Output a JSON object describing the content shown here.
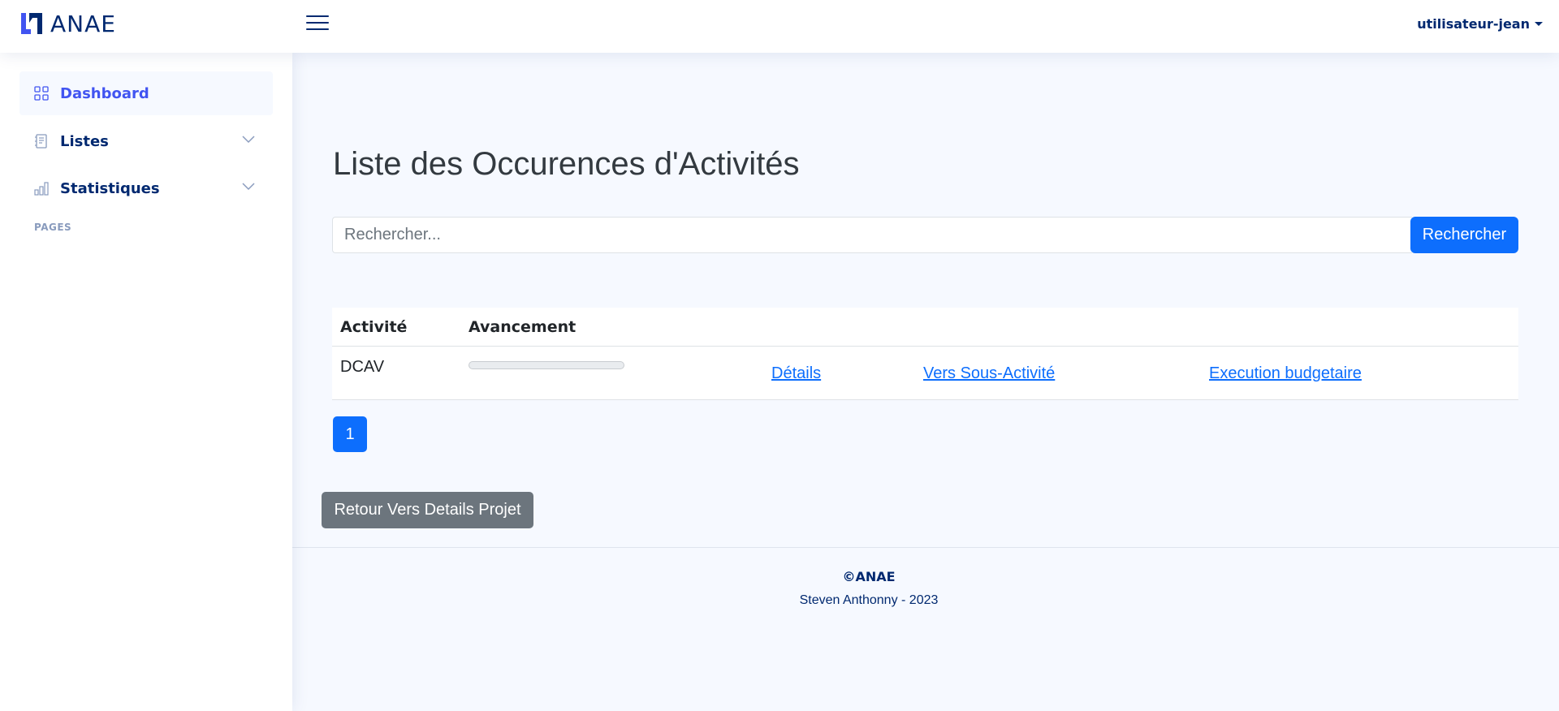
{
  "header": {
    "brand": "ANAE",
    "user": "utilisateur-jean"
  },
  "sidebar": {
    "items": [
      {
        "label": "Dashboard",
        "icon": "grid-icon",
        "active": true
      },
      {
        "label": "Listes",
        "icon": "journal-icon",
        "expandable": true
      },
      {
        "label": "Statistiques",
        "icon": "bar-chart-icon",
        "expandable": true
      }
    ],
    "heading": "PAGES"
  },
  "main": {
    "title": "Liste des Occurences d'Activités",
    "search": {
      "placeholder": "Rechercher...",
      "value": "",
      "button_label": "Rechercher"
    },
    "table": {
      "headers": [
        "Activité",
        "Avancement"
      ],
      "rows": [
        {
          "activity": "DCAV",
          "progress": 0,
          "links": [
            "Détails",
            "Vers Sous-Activité",
            "Execution budgetaire"
          ]
        }
      ]
    },
    "pagination": {
      "current": "1"
    },
    "back_button": "Retour Vers Details Projet"
  },
  "footer": {
    "copyright": "©ANAE",
    "credit": "Steven Anthonny - 2023"
  },
  "colors": {
    "primary": "#0d6efd",
    "brand": "#4154f1",
    "navy": "#012970",
    "secondary": "#6c757d",
    "background": "#f6f9ff"
  }
}
